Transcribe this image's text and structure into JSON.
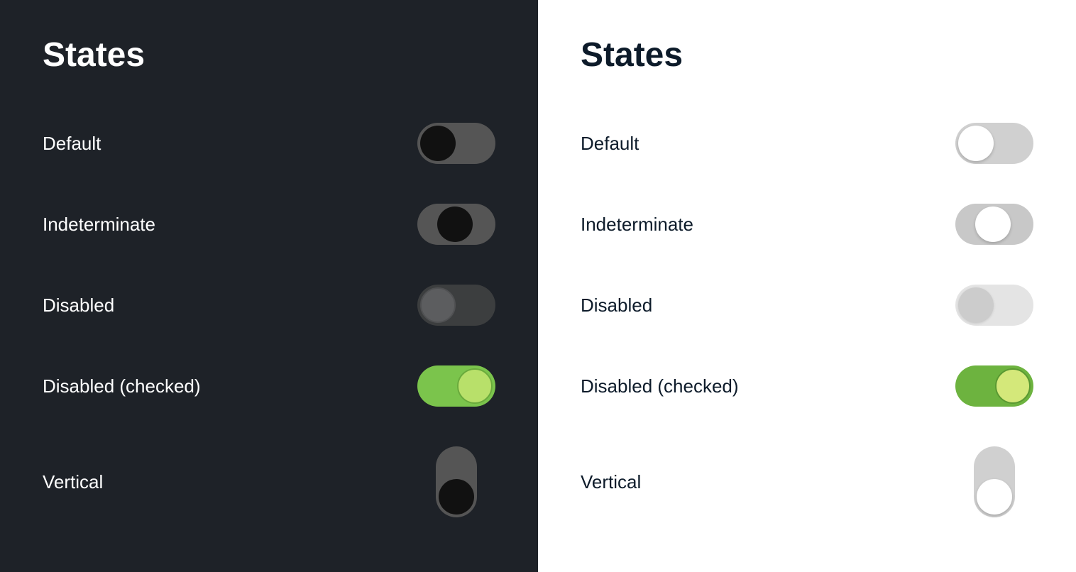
{
  "left_panel": {
    "title": "States",
    "theme": "dark",
    "rows": [
      {
        "id": "default",
        "label": "Default"
      },
      {
        "id": "indeterminate",
        "label": "Indeterminate"
      },
      {
        "id": "disabled",
        "label": "Disabled"
      },
      {
        "id": "disabled-checked",
        "label": "Disabled (checked)"
      },
      {
        "id": "vertical",
        "label": "Vertical"
      }
    ]
  },
  "right_panel": {
    "title": "States",
    "theme": "light",
    "rows": [
      {
        "id": "default",
        "label": "Default"
      },
      {
        "id": "indeterminate",
        "label": "Indeterminate"
      },
      {
        "id": "disabled",
        "label": "Disabled"
      },
      {
        "id": "disabled-checked",
        "label": "Disabled (checked)"
      },
      {
        "id": "vertical",
        "label": "Vertical"
      }
    ]
  }
}
